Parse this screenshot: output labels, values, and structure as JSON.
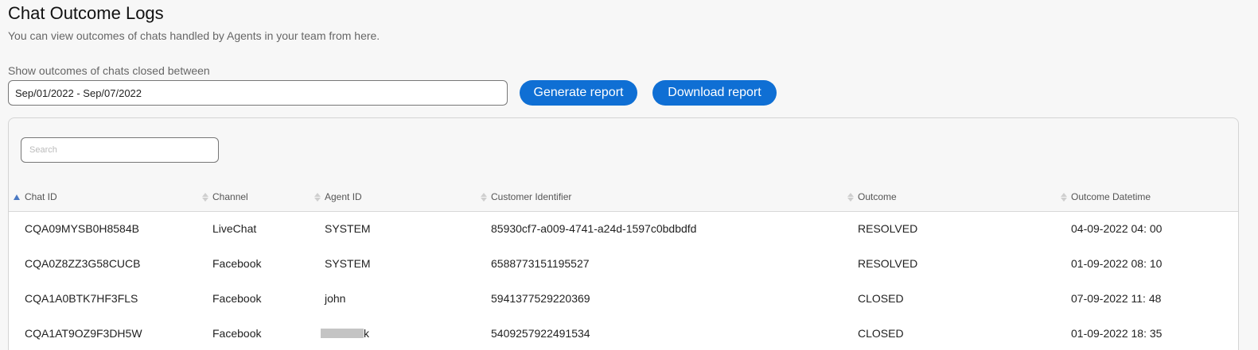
{
  "page": {
    "title": "Chat Outcome Logs",
    "subtitle": "You can view outcomes of chats handled by Agents in your team from here.",
    "range_label": "Show outcomes of chats closed between",
    "date_range_value": "Sep/01/2022 - Sep/07/2022"
  },
  "actions": {
    "generate_label": "Generate report",
    "download_label": "Download report"
  },
  "search": {
    "placeholder": "Search"
  },
  "colors": {
    "primary_button": "#0f6fd4",
    "sort_active": "#4a78c2"
  },
  "table": {
    "columns": [
      "Chat ID",
      "Channel",
      "Agent ID",
      "Customer Identifier",
      "Outcome",
      "Outcome Datetime"
    ],
    "sort": {
      "column": "Chat ID",
      "direction": "ascending"
    },
    "rows": [
      {
        "chat_id": "CQA09MYSB0H8584B",
        "channel": "LiveChat",
        "agent_id": "SYSTEM",
        "customer_identifier": "85930cf7-a009-4741-a24d-1597c0bdbdfd",
        "outcome": "RESOLVED",
        "outcome_datetime": "04-09-2022 04: 00"
      },
      {
        "chat_id": "CQA0Z8ZZ3G58CUCB",
        "channel": "Facebook",
        "agent_id": "SYSTEM",
        "customer_identifier": "6588773151195527",
        "outcome": "RESOLVED",
        "outcome_datetime": "01-09-2022 08: 10"
      },
      {
        "chat_id": "CQA1A0BTK7HF3FLS",
        "channel": "Facebook",
        "agent_id": "john",
        "customer_identifier": "5941377529220369",
        "outcome": "CLOSED",
        "outcome_datetime": "07-09-2022 11: 48"
      },
      {
        "chat_id": "CQA1AT9OZ9F3DH5W",
        "channel": "Facebook",
        "agent_id": "k",
        "customer_identifier": "5409257922491534",
        "outcome": "CLOSED",
        "outcome_datetime": "01-09-2022 18: 35"
      }
    ]
  }
}
